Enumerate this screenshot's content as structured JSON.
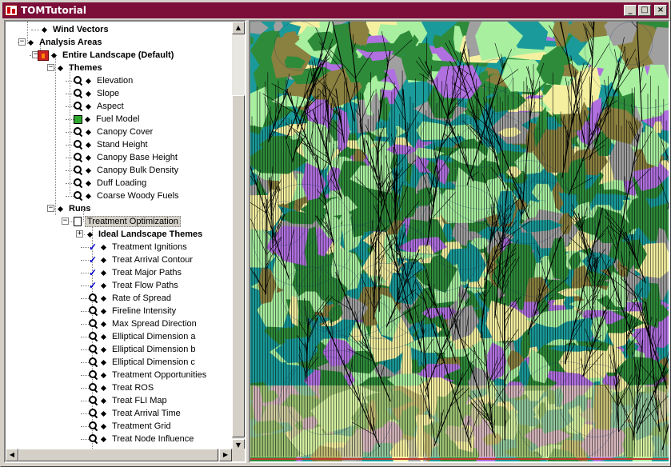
{
  "window": {
    "title": "TOMTutorial",
    "controls": {
      "minimize": "_",
      "maximize": "□",
      "close": "×"
    }
  },
  "tree": {
    "items": [
      {
        "label": "Wind Vectors",
        "bold": true,
        "icon": "none"
      },
      {
        "label": "Analysis Areas",
        "bold": true,
        "icon": "none",
        "expander": "minus"
      },
      {
        "label": "Entire Landscape (Default)",
        "bold": true,
        "icon": "fire-icon",
        "expander": "minus"
      },
      {
        "label": "Themes",
        "bold": true,
        "icon": "none",
        "expander": "minus"
      },
      {
        "label": "Elevation",
        "icon": "magnifier-icon"
      },
      {
        "label": "Slope",
        "icon": "magnifier-icon"
      },
      {
        "label": "Aspect",
        "icon": "magnifier-icon"
      },
      {
        "label": "Fuel Model",
        "icon": "green-square-icon"
      },
      {
        "label": "Canopy Cover",
        "icon": "magnifier-icon"
      },
      {
        "label": "Stand Height",
        "icon": "magnifier-icon"
      },
      {
        "label": "Canopy Base Height",
        "icon": "magnifier-icon"
      },
      {
        "label": "Canopy Bulk Density",
        "icon": "magnifier-icon"
      },
      {
        "label": "Duff Loading",
        "icon": "magnifier-icon"
      },
      {
        "label": "Coarse Woody Fuels",
        "icon": "magnifier-icon"
      },
      {
        "label": "Runs",
        "bold": true,
        "icon": "none",
        "expander": "minus"
      },
      {
        "label": "Treatment Optimization",
        "icon": "document-icon",
        "expander": "minus",
        "selected": true
      },
      {
        "label": "Ideal Landscape Themes",
        "bold": true,
        "icon": "none",
        "expander": "plus"
      },
      {
        "label": "Treatment Ignitions",
        "icon": "check-icon"
      },
      {
        "label": "Treat Arrival Contour",
        "icon": "check-icon"
      },
      {
        "label": "Treat Major Paths",
        "icon": "check-icon"
      },
      {
        "label": "Treat Flow Paths",
        "icon": "check-icon"
      },
      {
        "label": "Rate of Spread",
        "icon": "magnifier-icon"
      },
      {
        "label": "Fireline Intensity",
        "icon": "magnifier-icon"
      },
      {
        "label": "Max Spread Direction",
        "icon": "magnifier-icon"
      },
      {
        "label": "Elliptical Dimension a",
        "icon": "magnifier-icon"
      },
      {
        "label": "Elliptical Dimension b",
        "icon": "magnifier-icon"
      },
      {
        "label": "Elliptical Dimension c",
        "icon": "magnifier-icon"
      },
      {
        "label": "Treatment Opportunities",
        "icon": "magnifier-icon"
      },
      {
        "label": "Treat ROS",
        "icon": "magnifier-icon"
      },
      {
        "label": "Treat FLI Map",
        "icon": "magnifier-icon"
      },
      {
        "label": "Treat Arrival Time",
        "icon": "magnifier-icon"
      },
      {
        "label": "Treatment Grid",
        "icon": "magnifier-icon"
      },
      {
        "label": "Treat Node Influence",
        "icon": "magnifier-icon"
      }
    ]
  },
  "map": {
    "palette": {
      "teal": "#1a9a9a",
      "green": "#2e8b3a",
      "light_green": "#a8f0a0",
      "yellow": "#f5f0a0",
      "olive": "#8a8040",
      "purple": "#b070e0",
      "gray": "#a0a0a0",
      "path": "#000000",
      "border": "#c0392b"
    }
  }
}
